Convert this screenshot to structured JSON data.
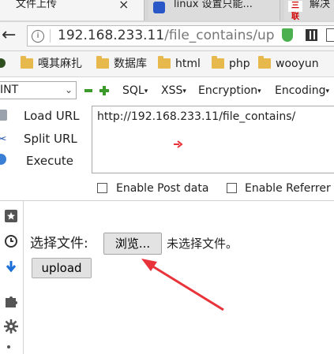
{
  "tabs": [
    {
      "label": "文件上传",
      "active": true,
      "close_glyph": "×"
    },
    {
      "label": "linux 设置只能...",
      "active": false
    },
    {
      "label": "解决",
      "active": false,
      "icon_text": "三联"
    }
  ],
  "nav": {
    "url_host": "192.168.233.11",
    "url_path": "/file_contains/up",
    "icons": [
      "back-arrow-icon",
      "info-icon",
      "shield-icon",
      "qr-code-icon",
      "reader-icon"
    ]
  },
  "bookmarks": [
    {
      "label": "嘎其麻扎"
    },
    {
      "label": "数据库"
    },
    {
      "label": "html"
    },
    {
      "label": "php"
    },
    {
      "label": "wooyun"
    }
  ],
  "hackbar": {
    "version_value": "INT",
    "version_arrow": "⌄",
    "menus": [
      {
        "label": "SQL",
        "arrow": "▾"
      },
      {
        "label": "XSS",
        "arrow": "▾"
      },
      {
        "label": "Encryption",
        "arrow": "▾"
      },
      {
        "label": "Encoding",
        "arrow": "▾"
      }
    ],
    "actions": {
      "load": "Load URL",
      "split": "Split URL",
      "execute": "Execute"
    },
    "textarea_value": "http://192.168.233.11/file_contains/",
    "enable_post": "Enable Post data",
    "enable_referrer": "Enable Referrer",
    "post_checked": false,
    "referrer_checked": false
  },
  "sidebar": {
    "icons": [
      "bookmark-star-icon",
      "history-clock-icon",
      "download-arrow-icon",
      "puzzle-addon-icon",
      "settings-gear-icon"
    ]
  },
  "page": {
    "file_label": "选择文件:",
    "browse_label": "浏览...",
    "no_file_text": "未选择文件。",
    "upload_label": "upload"
  },
  "colors": {
    "annotation_red": "#e8333a",
    "hackbar_green": "#3c9a2b",
    "folder_yellow": "#e7b94c"
  }
}
